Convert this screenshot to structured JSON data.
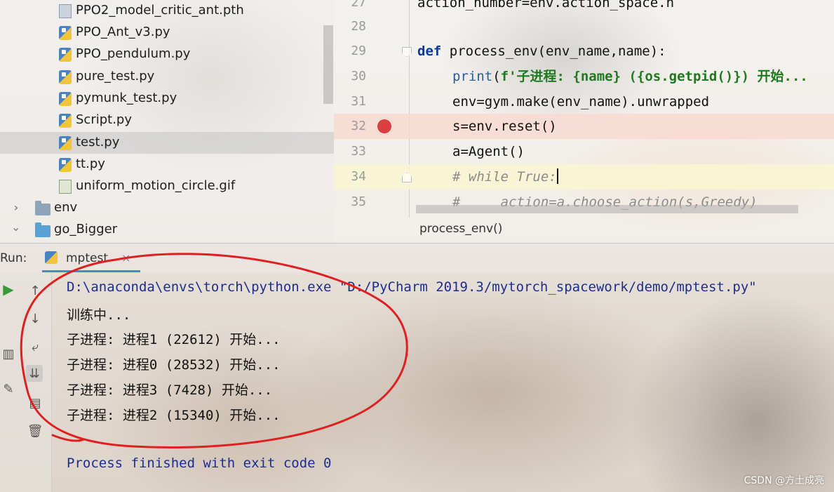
{
  "project_tree": {
    "items": [
      {
        "label": "PPO2_model_critic_ant.pth",
        "icon": "unknown-file-icon"
      },
      {
        "label": "PPO_Ant_v3.py",
        "icon": "python-file-icon"
      },
      {
        "label": "PPO_pendulum.py",
        "icon": "python-file-icon"
      },
      {
        "label": "pure_test.py",
        "icon": "python-file-icon"
      },
      {
        "label": "pymunk_test.py",
        "icon": "python-file-icon"
      },
      {
        "label": "Script.py",
        "icon": "python-file-icon"
      },
      {
        "label": "test.py",
        "icon": "python-file-icon",
        "selected": true
      },
      {
        "label": "tt.py",
        "icon": "python-file-icon"
      },
      {
        "label": "uniform_motion_circle.gif",
        "icon": "gif-file-icon"
      },
      {
        "label": "env",
        "icon": "folder-icon",
        "expanded": false
      },
      {
        "label": "go_Bigger",
        "icon": "folder-icon",
        "expanded": true
      }
    ]
  },
  "editor": {
    "lines": [
      {
        "num": "27",
        "text": "action_number=env.action_space.n"
      },
      {
        "num": "28",
        "text": ""
      },
      {
        "num": "29",
        "text": "def process_env(env_name,name):"
      },
      {
        "num": "30",
        "text": "print(f'子进程: {name} ({os.getpid()}) 开始..."
      },
      {
        "num": "31",
        "text": "env=gym.make(env_name).unwrapped"
      },
      {
        "num": "32",
        "text": "s=env.reset()",
        "breakpoint": true
      },
      {
        "num": "33",
        "text": "a=Agent()"
      },
      {
        "num": "34",
        "text": "# while True:",
        "current": true
      },
      {
        "num": "35",
        "text": "#     action=a.choose_action(s,Greedy)"
      }
    ],
    "parts": {
      "def_kw": "def",
      "def_rest": " process_env(env_name,name):",
      "print_fn": "print",
      "print_open": "(",
      "fstr": "f'子进程: {name} ({os.getpid()}) 开始..."
    },
    "breadcrumb": "process_env()"
  },
  "run_panel": {
    "label": "Run:",
    "tab_label": "mptest",
    "tab_close": "×",
    "console": [
      "D:\\anaconda\\envs\\torch\\python.exe \"D:/PyCharm 2019.3/mytorch_spacework/demo/mptest.py\"",
      "训练中...",
      "子进程: 进程1 (22612) 开始...",
      "子进程: 进程0 (28532) 开始...",
      "子进程: 进程3 (7428) 开始...",
      "子进程: 进程2 (15340) 开始...",
      "",
      "Process finished with exit code 0"
    ],
    "tools": [
      "play-icon",
      "arrow-up-icon",
      "arrow-down-icon",
      "soft-wrap-icon",
      "scroll-to-end-icon",
      "pin-icon",
      "print-icon",
      "trash-icon"
    ]
  },
  "watermark": "CSDN @方土成亮",
  "colors": {
    "keyword": "#0b3a9e",
    "fstring": "#1f7a1f",
    "comment": "#8a8a8a",
    "breakpoint": "#db3e3e",
    "console_path": "#1d2e8a",
    "annotation": "#e02020"
  }
}
